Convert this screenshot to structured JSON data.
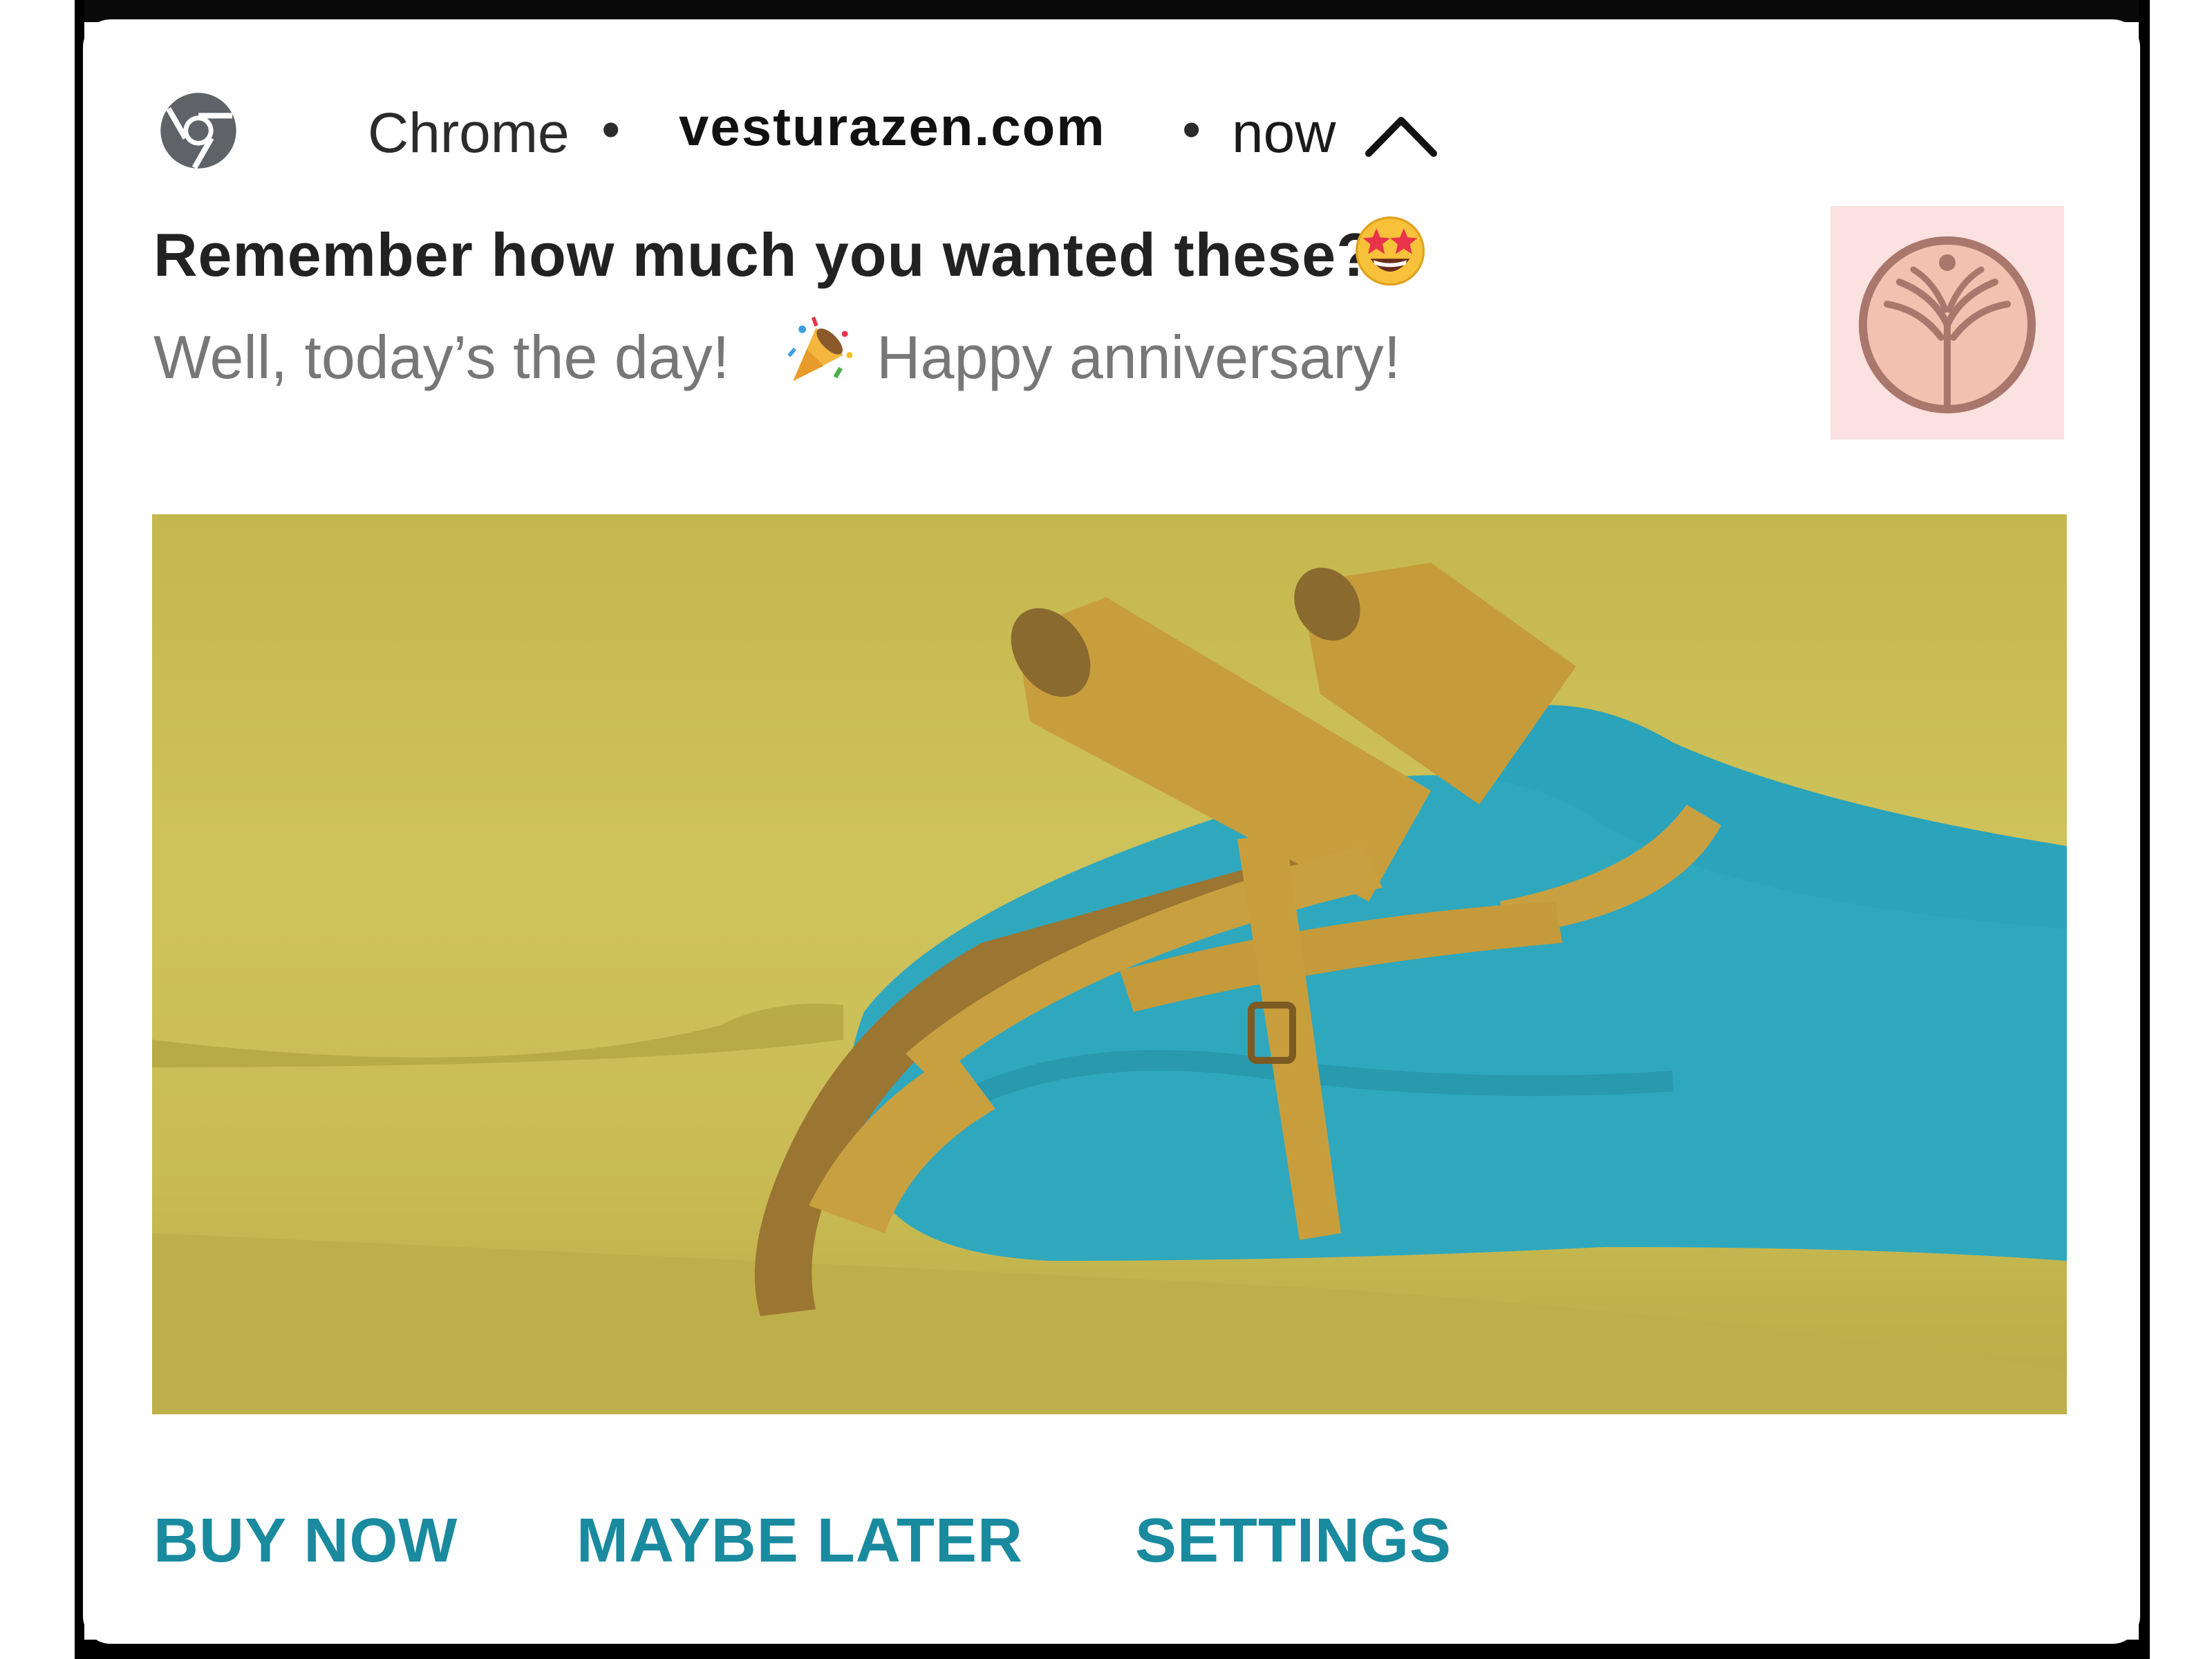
{
  "notification": {
    "app_name": "Chrome",
    "separator": "•",
    "domain": "vesturazen.com",
    "time": "now",
    "icon_app": "chrome-icon",
    "icon_expand": "chevron-up-icon",
    "title": "Remember how much you wanted these?",
    "title_emoji": "star-struck-emoji",
    "subtitle_part1": "Well, today’s the day!",
    "subtitle_emoji": "party-popper-emoji",
    "subtitle_part2": "Happy anniversary!",
    "large_icon": "brand-logo-tree-icon",
    "hero_image": "yellow-sandals-on-blue-tights-photo"
  },
  "actions": {
    "buy_now": "BUY NOW",
    "maybe_later": "MAYBE LATER",
    "settings": "SETTINGS"
  },
  "colors": {
    "action_text": "#1a8a9f",
    "subtitle_text": "#777777",
    "logo_background": "#fbe1e0",
    "logo_stroke": "#a9776c"
  }
}
